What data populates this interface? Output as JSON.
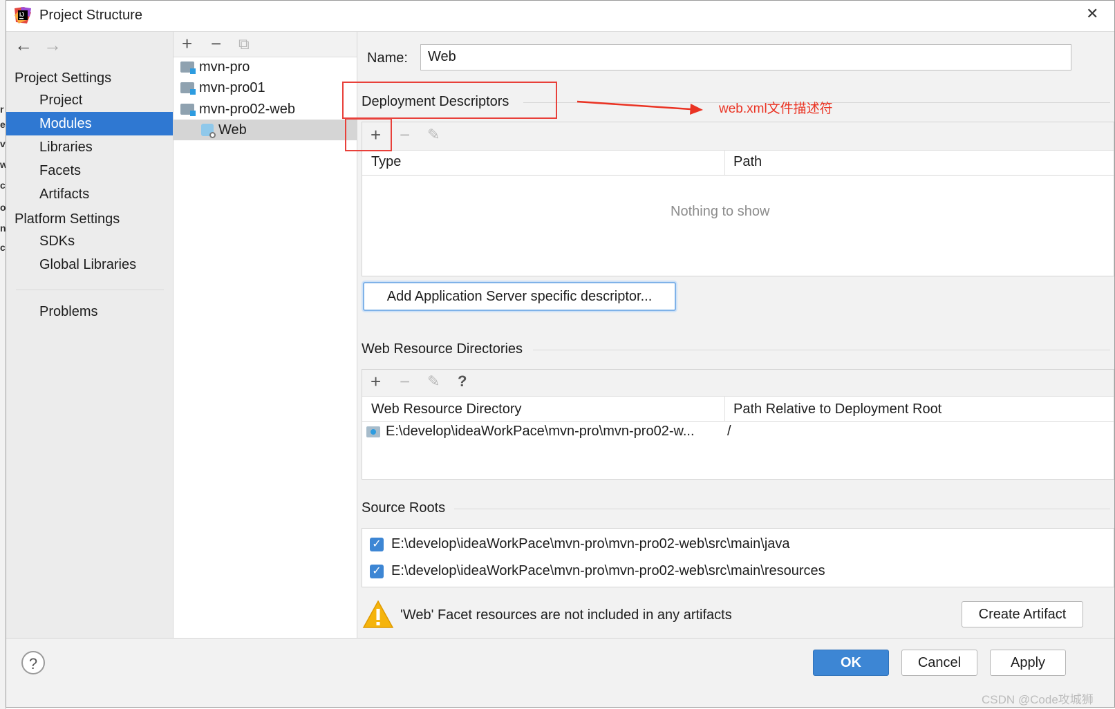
{
  "background_window": {
    "edge_chars": [
      "r",
      "e",
      "v",
      "w",
      "c",
      "o",
      "n",
      "c"
    ]
  },
  "window": {
    "title": "Project Structure",
    "close_glyph": "✕"
  },
  "nav": {
    "back_glyph": "←",
    "forward_glyph": "→",
    "project_settings_header": "Project Settings",
    "project_settings_items": [
      "Project",
      "Modules",
      "Libraries",
      "Facets",
      "Artifacts"
    ],
    "platform_settings_header": "Platform Settings",
    "platform_settings_items": [
      "SDKs",
      "Global Libraries"
    ],
    "problems_label": "Problems",
    "selected": "Modules"
  },
  "module_tree": {
    "toolbar": {
      "add_glyph": "+",
      "remove_glyph": "−",
      "copy_glyph": "⧉"
    },
    "items": [
      {
        "label": "mvn-pro",
        "icon": "module-folder-icon"
      },
      {
        "label": "mvn-pro01",
        "icon": "module-folder-icon"
      },
      {
        "label": "mvn-pro02-web",
        "icon": "module-folder-icon"
      },
      {
        "label": "Web",
        "icon": "web-facet-icon"
      }
    ],
    "selected": "Web"
  },
  "facet": {
    "name_label": "Name:",
    "name_value": "Web",
    "deployment_descriptors": {
      "title": "Deployment Descriptors",
      "toolbar": {
        "add": "+",
        "remove": "−",
        "edit": "✎"
      },
      "columns": [
        "Type",
        "Path"
      ],
      "empty_text": "Nothing to show",
      "add_server_descriptor_button": "Add Application Server specific descriptor..."
    },
    "web_resource_directories": {
      "title": "Web Resource Directories",
      "toolbar": {
        "add": "+",
        "remove": "−",
        "edit": "✎",
        "help": "?"
      },
      "columns": [
        "Web Resource Directory",
        "Path Relative to Deployment Root"
      ],
      "rows": [
        {
          "directory": "E:\\develop\\ideaWorkPace\\mvn-pro\\mvn-pro02-w...",
          "relative_path": "/"
        }
      ]
    },
    "source_roots": {
      "title": "Source Roots",
      "items": [
        {
          "path": "E:\\develop\\ideaWorkPace\\mvn-pro\\mvn-pro02-web\\src\\main\\java",
          "checked": true
        },
        {
          "path": "E:\\develop\\ideaWorkPace\\mvn-pro\\mvn-pro02-web\\src\\main\\resources",
          "checked": true
        }
      ]
    },
    "warning": {
      "icon": "warning-icon",
      "text": "'Web' Facet resources are not included in any artifacts",
      "create_artifact_button": "Create Artifact"
    }
  },
  "annotation": {
    "text": "web.xml文件描述符",
    "color": "#ea3323"
  },
  "footer": {
    "help_glyph": "?",
    "ok_label": "OK",
    "cancel_label": "Cancel",
    "apply_label": "Apply"
  },
  "watermark": "CSDN @Code攻城狮",
  "colors": {
    "selection": "#2f78d2",
    "primary_button": "#3d86d4",
    "annotation_red": "#ea3323",
    "warning_yellow": "#f5b40c"
  }
}
